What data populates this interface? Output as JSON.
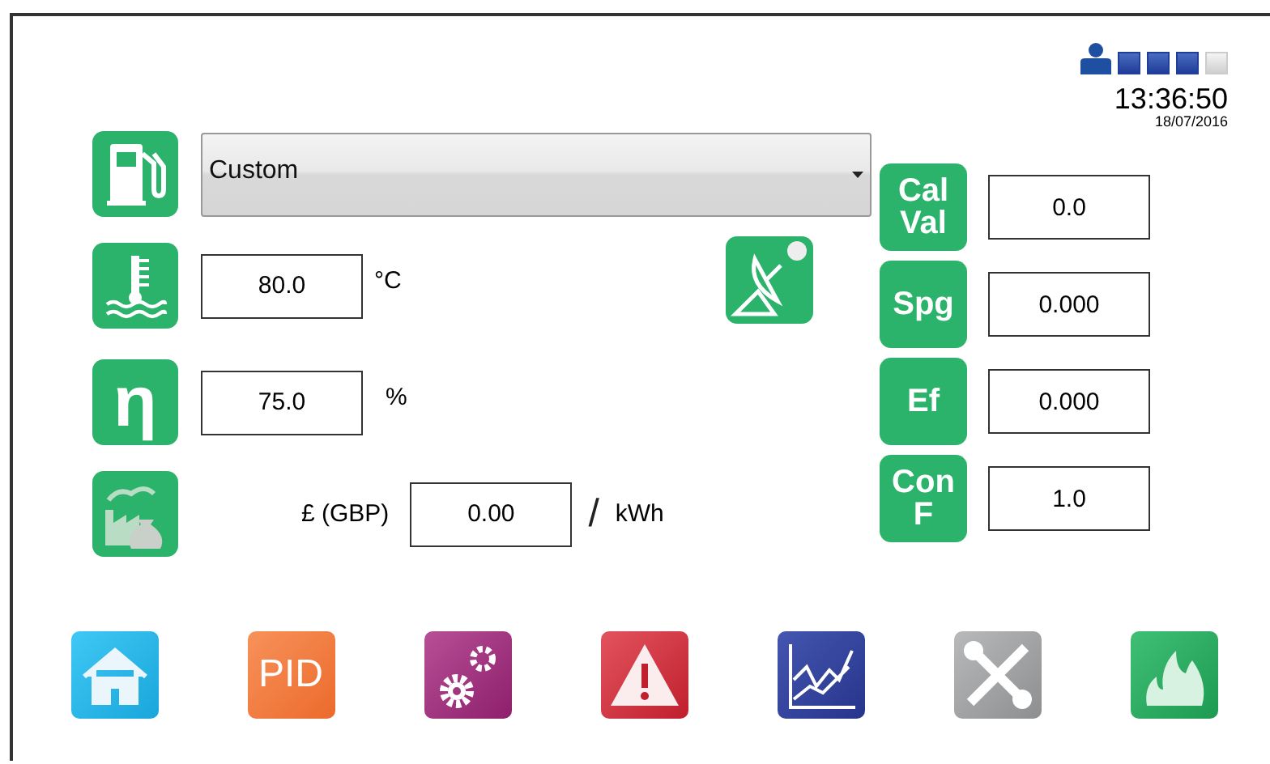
{
  "status": {
    "indicators": [
      {
        "on": true
      },
      {
        "on": true
      },
      {
        "on": true
      },
      {
        "on": false
      }
    ],
    "time": "13:36:50",
    "date": "18/07/2016"
  },
  "fuel": {
    "value": "Custom"
  },
  "temperature": {
    "value": "80.0",
    "unit": "°C"
  },
  "efficiency": {
    "symbol": "η",
    "value": "75.0",
    "unit": "%"
  },
  "cost": {
    "currency": "£ (GBP)",
    "value": "0.00",
    "separator": "/",
    "unit": "kWh"
  },
  "constants": [
    {
      "label": "Cal Val",
      "value": "0.0"
    },
    {
      "label": "Spg",
      "value": "0.000"
    },
    {
      "label": "Ef",
      "value": "0.000"
    },
    {
      "label": "Con F",
      "value": "1.0"
    }
  ],
  "nav": [
    {
      "kind": "home"
    },
    {
      "kind": "pid",
      "label": "PID"
    },
    {
      "kind": "gears"
    },
    {
      "kind": "alarm"
    },
    {
      "kind": "chart"
    },
    {
      "kind": "tools"
    },
    {
      "kind": "flame"
    }
  ]
}
